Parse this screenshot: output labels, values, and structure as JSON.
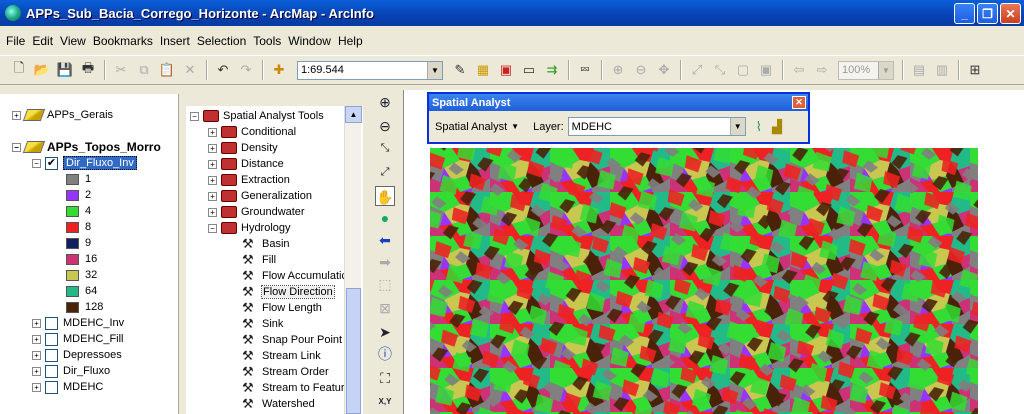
{
  "window": {
    "title": "APPs_Sub_Bacia_Corrego_Horizonte - ArcMap - ArcInfo"
  },
  "menu": [
    "File",
    "Edit",
    "View",
    "Bookmarks",
    "Insert",
    "Selection",
    "Tools",
    "Window",
    "Help"
  ],
  "toolbar": {
    "scale": "1:69.544",
    "zoom": "100%"
  },
  "toc": {
    "groups": [
      {
        "label": "APPs_Gerais"
      },
      {
        "label": "APPs_Topos_Morro"
      }
    ],
    "active_layer": "Dir_Fluxo_Inv",
    "legend": [
      {
        "label": "1",
        "color": "#808080"
      },
      {
        "label": "2",
        "color": "#9933ff"
      },
      {
        "label": "4",
        "color": "#33dd33"
      },
      {
        "label": "8",
        "color": "#ee2222"
      },
      {
        "label": "9",
        "color": "#102060"
      },
      {
        "label": "16",
        "color": "#cc3377"
      },
      {
        "label": "32",
        "color": "#c8c850"
      },
      {
        "label": "64",
        "color": "#22bb88"
      },
      {
        "label": "128",
        "color": "#4a2208"
      }
    ],
    "other_layers": [
      "MDEHC_Inv",
      "MDEHC_Fill",
      "Depressoes",
      "Dir_Fluxo",
      "MDEHC"
    ]
  },
  "toolbox": {
    "root": "Spatial Analyst Tools",
    "sets": [
      "Conditional",
      "Density",
      "Distance",
      "Extraction",
      "Generalization",
      "Groundwater",
      "Hydrology"
    ],
    "hydrology_tools": [
      "Basin",
      "Fill",
      "Flow Accumulatic",
      "Flow Direction",
      "Flow Length",
      "Sink",
      "Snap Pour Point",
      "Stream Link",
      "Stream Order",
      "Stream to Featur",
      "Watershed"
    ]
  },
  "spatial_analyst": {
    "title": "Spatial Analyst",
    "menu_label": "Spatial Analyst",
    "layer_label": "Layer:",
    "layer_value": "MDEHC"
  },
  "toolstrip": {
    "xy_label": "X,Y"
  }
}
